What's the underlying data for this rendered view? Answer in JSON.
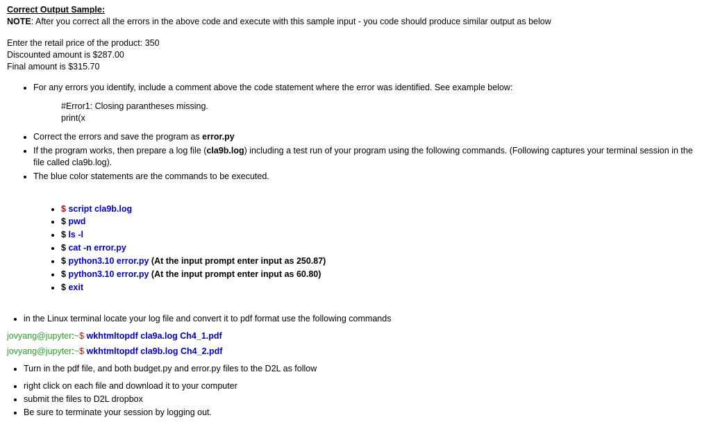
{
  "header": {
    "title": "Correct Output Sample:",
    "note_label": "NOTE",
    "note_text": ": After you correct all the errors in the above code and execute with this sample input - you code should produce similar output as below"
  },
  "sample": {
    "line1": "Enter the retail price of the product: 350",
    "line2": "Discounted amount is $287.00",
    "line3": "Final amount is $315.70"
  },
  "instructions": {
    "item1": "For any errors you identify, include a comment above the code statement where the error was identified. See example below:",
    "error_comment": "#Error1: Closing parantheses missing.",
    "error_code": "print(x",
    "item2_pre": "Correct the errors and save the program as ",
    "item2_file": "error.py",
    "item3_pre": "If the program works, then prepare a log file (",
    "item3_file": "cla9b.log",
    "item3_post": ") including a test run of your program using the following commands. (Following captures your terminal session in the file called cla9b.log).",
    "item4": "The blue color statements are the commands to be executed."
  },
  "commands": {
    "c1_dollar": "$ ",
    "c1_cmd": "script cla9b.log",
    "c2_dollar": "$ ",
    "c2_cmd": "pwd",
    "c3_dollar": "$ ",
    "c3_cmd": "ls -l",
    "c4_dollar": "$ ",
    "c4_cmd": "cat -n error.py",
    "c5_dollar": "$ ",
    "c5_cmd": "python3.10 error.py",
    "c5_note": " (At the input prompt enter input as  250.87)",
    "c6_dollar": "$ ",
    "c6_cmd": "python3.10 error.py",
    "c6_note": " (At the input prompt enter input as  60.80)",
    "c7_dollar": "$ ",
    "c7_cmd": "exit"
  },
  "pdf": {
    "intro": "in the Linux terminal locate your log file and convert it to pdf format use the following commands",
    "prompt_user": "jovyang@jupyter",
    "prompt_colon": ":",
    "prompt_tilde": "~",
    "prompt_dollar": "$ ",
    "cmd1": "wkhtmltopdf  cla9a.log   Ch4_1.pdf",
    "cmd2": "wkhtmltopdf  cla9b.log   Ch4_2.pdf"
  },
  "final": {
    "f1": "Turn in the pdf file, and both budget.py and error.py files to the D2L as follow",
    "f2": "right click on each file and download it to your computer",
    "f3": "submit the files to D2L dropbox",
    "f4": "Be sure to terminate your session by logging out."
  }
}
